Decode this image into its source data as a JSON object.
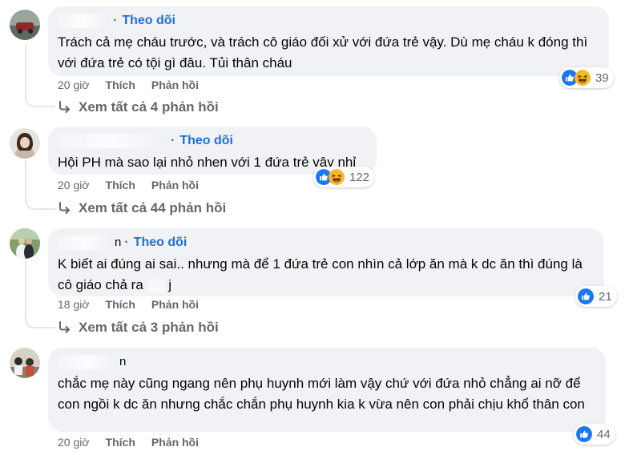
{
  "comments": [
    {
      "name_tail": "",
      "follow": "Theo dõi",
      "text": "Trách cả mẹ cháu trước, và trách cô giáo đối xử với đứa trẻ vậy. Dù mẹ cháu k đóng thì với đứa trẻ có tội gì đâu. Tủi thân cháu",
      "time": "20 giờ",
      "like": "Thích",
      "reply": "Phản hồi",
      "reaction_icons": [
        "like-icon",
        "haha-icon"
      ],
      "reaction_count": "39",
      "view_replies": "Xem tất cả 4 phản hồi"
    },
    {
      "name_tail": "",
      "follow": "Theo dõi",
      "text": "Hội PH mà sao lại nhỏ nhen với 1 đứa trẻ vậy nhỉ",
      "time": "20 giờ",
      "like": "Thích",
      "reply": "Phản hồi",
      "reaction_icons": [
        "like-icon",
        "haha-icon"
      ],
      "reaction_count": "122",
      "view_replies": "Xem tất cả 44 phản hồi"
    },
    {
      "name_tail": "n",
      "follow": "Theo dõi",
      "text_a": "K biết ai đúng ai sai.. nhưng mà để 1 đứa trẻ con nhìn cả lớp ăn mà k dc ăn thì đúng là cô giáo chả ra",
      "text_b": "j",
      "time": "18 giờ",
      "like": "Thích",
      "reply": "Phản hồi",
      "reaction_icons": [
        "like-icon"
      ],
      "reaction_count": "21",
      "view_replies": "Xem tất cả 3 phản hồi"
    },
    {
      "name_tail": "n",
      "text": "chắc mẹ này cũng ngang nên phụ huynh mới làm vậy chứ với đứa nhỏ chẳng ai nỡ để con ngồi k dc ăn nhưng chắc chắn phụ huynh kia k vừa nên con phải chịu khổ thân con",
      "time": "20 giờ",
      "like": "Thích",
      "reply": "Phản hồi",
      "reaction_icons": [
        "like-icon"
      ],
      "reaction_count": "44"
    }
  ],
  "colors": {
    "bubble": "#f0f2f5",
    "follow_link": "#216fdb",
    "muted": "#65676b",
    "like_blue": "#1877f2",
    "haha_yellow": "#f7b928"
  }
}
